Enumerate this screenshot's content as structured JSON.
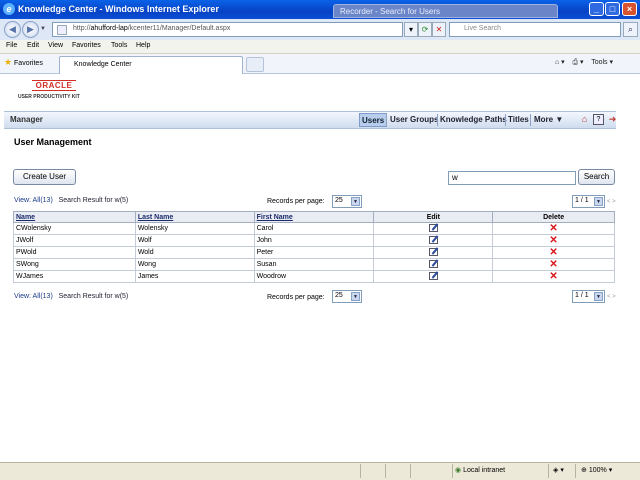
{
  "window": {
    "title": "Knowledge Center - Windows Internet Explorer",
    "recorder_title": "Recorder - Search for Users"
  },
  "address_bar": {
    "url_prefix": "http://",
    "url_host": "ahufford-lap",
    "url_path": "/kcenter11/Manager/Default.aspx",
    "live_search_placeholder": "Live Search"
  },
  "menu": [
    "File",
    "Edit",
    "View",
    "Favorites",
    "Tools",
    "Help"
  ],
  "favorites_bar": {
    "favorites_label": "Favorites",
    "tab_label": "Knowledge Center",
    "tools_label": "Tools"
  },
  "logo": {
    "brand": "ORACLE",
    "product": "USER PRODUCTIVITY KIT"
  },
  "header": {
    "title": "Manager",
    "nav": [
      "Users",
      "User Groups",
      "Knowledge Paths",
      "Titles",
      "More"
    ]
  },
  "page": {
    "title": "User Management",
    "create_button": "Create User",
    "search_value": "w",
    "search_button": "Search"
  },
  "results": {
    "view_all": "View: All(13)",
    "search_result": "Search Result for w(5)",
    "records_per_page_label": "Records per page:",
    "records_per_page_value": "25",
    "page_value": "1 / 1",
    "page_nav": "< >"
  },
  "table": {
    "columns": [
      "Name",
      "Last Name",
      "First Name",
      "Edit",
      "Delete"
    ],
    "rows": [
      {
        "name": "CWolensky",
        "last": "Wolensky",
        "first": "Carol"
      },
      {
        "name": "JWolf",
        "last": "Wolf",
        "first": "John"
      },
      {
        "name": "PWold",
        "last": "Wold",
        "first": "Peter"
      },
      {
        "name": "SWong",
        "last": "Wong",
        "first": "Susan"
      },
      {
        "name": "WJames",
        "last": "James",
        "first": "Woodrow"
      }
    ]
  },
  "status_bar": {
    "zone": "Local intranet",
    "zoom": "100%"
  },
  "colors": {
    "titlebar": "#0642c4",
    "header_bar": "#cfdcef",
    "oracle_red": "#d32c25",
    "delete_red": "#d6141a"
  }
}
